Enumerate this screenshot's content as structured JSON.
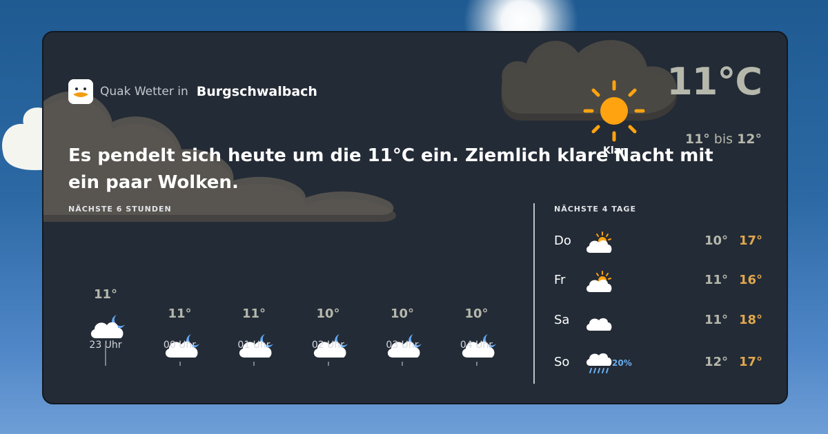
{
  "header": {
    "brand": "Quak Wetter in",
    "city": "Burgschwalbach"
  },
  "current": {
    "temperature": "11°C",
    "min": "11°",
    "range_word": "bis",
    "max": "12°",
    "condition": "Klar",
    "icon": "sun-icon"
  },
  "summary": "Es pendelt sich heute um die 11°C ein. Ziemlich klare Nacht mit ein paar Wolken.",
  "hourly": {
    "label": "NÄCHSTE 6 STUNDEN",
    "items": [
      {
        "temp": "11°",
        "time": "23 Uhr",
        "icon": "cloud-moon-icon"
      },
      {
        "temp": "11°",
        "time": "00 Uhr",
        "icon": "cloud-moon-icon"
      },
      {
        "temp": "11°",
        "time": "01 Uhr",
        "icon": "cloud-moon-icon"
      },
      {
        "temp": "10°",
        "time": "02 Uhr",
        "icon": "cloud-moon-icon"
      },
      {
        "temp": "10°",
        "time": "03 Uhr",
        "icon": "cloud-moon-icon"
      },
      {
        "temp": "10°",
        "time": "04 Uhr",
        "icon": "cloud-moon-icon"
      }
    ]
  },
  "daily": {
    "label": "NÄCHSTE 4 TAGE",
    "items": [
      {
        "day": "Do",
        "icon": "cloud-sun-icon",
        "min": "10°",
        "max": "17°"
      },
      {
        "day": "Fr",
        "icon": "cloud-sun-icon",
        "min": "11°",
        "max": "16°"
      },
      {
        "day": "Sa",
        "icon": "cloud-icon",
        "min": "11°",
        "max": "18°"
      },
      {
        "day": "So",
        "icon": "cloud-rain-icon",
        "precip": "20%",
        "min": "12°",
        "max": "17°"
      }
    ]
  },
  "colors": {
    "card": "#232b36",
    "temp_grey": "#b6b8ac",
    "max_orange": "#e1a84e",
    "sun": "#ffa311",
    "moon": "#64a9f2",
    "precip_blue": "#6aaef0"
  }
}
